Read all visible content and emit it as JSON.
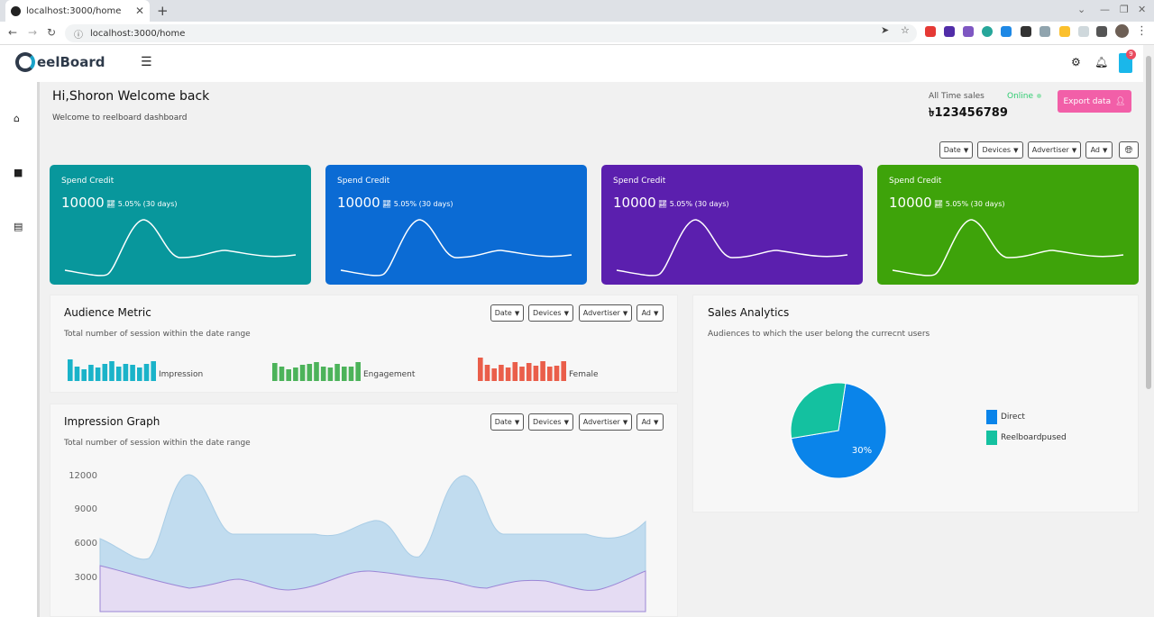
{
  "browser": {
    "tab_title": "localhost:3000/home",
    "url": "localhost:3000/home"
  },
  "app": {
    "logo_text": "eelBoard",
    "logo_letter_accent": "R"
  },
  "header": {
    "cart_count": "9"
  },
  "welcome": {
    "title": "Hi,Shoron Welcome back",
    "subtitle": "Welcome to reelboard dashboard"
  },
  "sales": {
    "label": "All Time sales",
    "status": "Online",
    "value": "৳123456789",
    "export_label": "Export data"
  },
  "filters": {
    "date": "Date",
    "devices": "Devices",
    "advertiser": "Advertiser",
    "ad": "Ad"
  },
  "cards": [
    {
      "title": "Spend Credit",
      "value": "10000",
      "change": "5.05% (30 days)",
      "color": "#08979c"
    },
    {
      "title": "Spend Credit",
      "value": "10000",
      "change": "5.05% (30 days)",
      "color": "#0b6bd4"
    },
    {
      "title": "Spend Credit",
      "value": "10000",
      "change": "5.05% (30 days)",
      "color": "#5b1fae"
    },
    {
      "title": "Spend Credit",
      "value": "10000",
      "change": "5.05% (30 days)",
      "color": "#3ea30a"
    }
  ],
  "audience": {
    "title": "Audience Metric",
    "subtitle": "Total number of session within the date range",
    "metrics": [
      {
        "label": "Impression",
        "color": "#1ab3c9"
      },
      {
        "label": "Engagement",
        "color": "#4cb35a"
      },
      {
        "label": "Female",
        "color": "#ea5e4a"
      }
    ]
  },
  "impression": {
    "title": "Impression Graph",
    "subtitle": "Total number of session within the date range",
    "y_ticks": [
      "12000",
      "9000",
      "6000",
      "3000"
    ]
  },
  "sales_analytics": {
    "title": "Sales Analytics",
    "subtitle": "Audiences to which the user belong the currecnt users",
    "slices": [
      {
        "label": "Direct",
        "value": 70,
        "display": "70%",
        "color": "#0a84ea"
      },
      {
        "label": "Reelboardpused",
        "value": 30,
        "display": "30%",
        "color": "#14c1a0"
      }
    ]
  }
}
